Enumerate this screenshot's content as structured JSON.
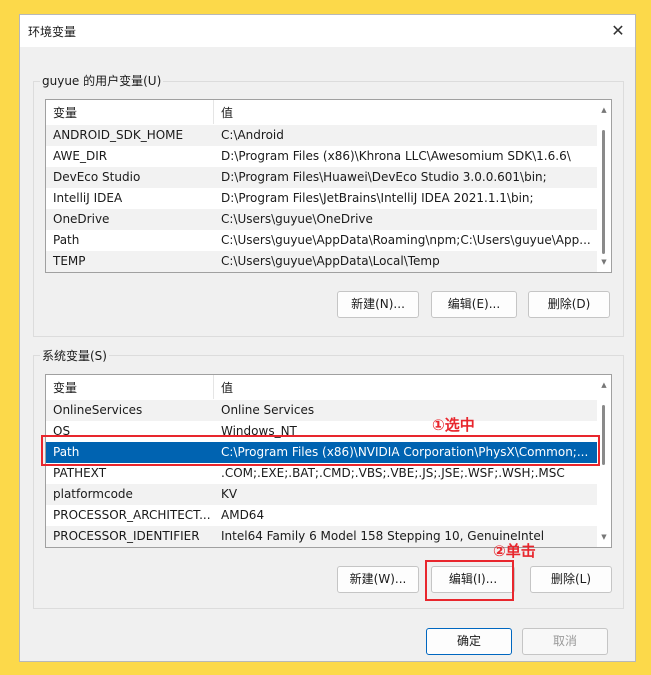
{
  "dialog": {
    "title": "环境变量",
    "close_glyph": "✕"
  },
  "user_vars": {
    "group_label": "guyue 的用户变量(U)",
    "headers": [
      "变量",
      "值"
    ],
    "rows": [
      {
        "name": "ANDROID_SDK_HOME",
        "value": "C:\\Android"
      },
      {
        "name": "AWE_DIR",
        "value": "D:\\Program Files (x86)\\Khrona LLC\\Awesomium SDK\\1.6.6\\"
      },
      {
        "name": "DevEco Studio",
        "value": "D:\\Program Files\\Huawei\\DevEco Studio 3.0.0.601\\bin;"
      },
      {
        "name": "IntelliJ IDEA",
        "value": "D:\\Program Files\\JetBrains\\IntelliJ IDEA 2021.1.1\\bin;"
      },
      {
        "name": "OneDrive",
        "value": "C:\\Users\\guyue\\OneDrive"
      },
      {
        "name": "Path",
        "value": "C:\\Users\\guyue\\AppData\\Roaming\\npm;C:\\Users\\guyue\\App..."
      },
      {
        "name": "TEMP",
        "value": "C:\\Users\\guyue\\AppData\\Local\\Temp"
      }
    ],
    "buttons": {
      "new": "新建(N)...",
      "edit": "编辑(E)...",
      "delete": "删除(D)"
    }
  },
  "system_vars": {
    "group_label": "系统变量(S)",
    "headers": [
      "变量",
      "值"
    ],
    "rows": [
      {
        "name": "OnlineServices",
        "value": "Online Services"
      },
      {
        "name": "OS",
        "value": "Windows_NT"
      },
      {
        "name": "Path",
        "value": "C:\\Program Files (x86)\\NVIDIA Corporation\\PhysX\\Common;..."
      },
      {
        "name": "PATHEXT",
        "value": ".COM;.EXE;.BAT;.CMD;.VBS;.VBE;.JS;.JSE;.WSF;.WSH;.MSC"
      },
      {
        "name": "platformcode",
        "value": "KV"
      },
      {
        "name": "PROCESSOR_ARCHITECT...",
        "value": "AMD64"
      },
      {
        "name": "PROCESSOR_IDENTIFIER",
        "value": "Intel64 Family 6 Model 158 Stepping 10, GenuineIntel"
      }
    ],
    "selected_row": "Path",
    "buttons": {
      "new": "新建(W)...",
      "edit": "编辑(I)...",
      "delete": "删除(L)"
    }
  },
  "footer": {
    "ok": "确定",
    "cancel": "取消"
  },
  "annotations": {
    "select": "①选中",
    "click": "②单击"
  },
  "colors": {
    "annotation_red": "#e8262d",
    "selection_blue": "#0063b1",
    "background_yellow": "#fcd94a"
  }
}
